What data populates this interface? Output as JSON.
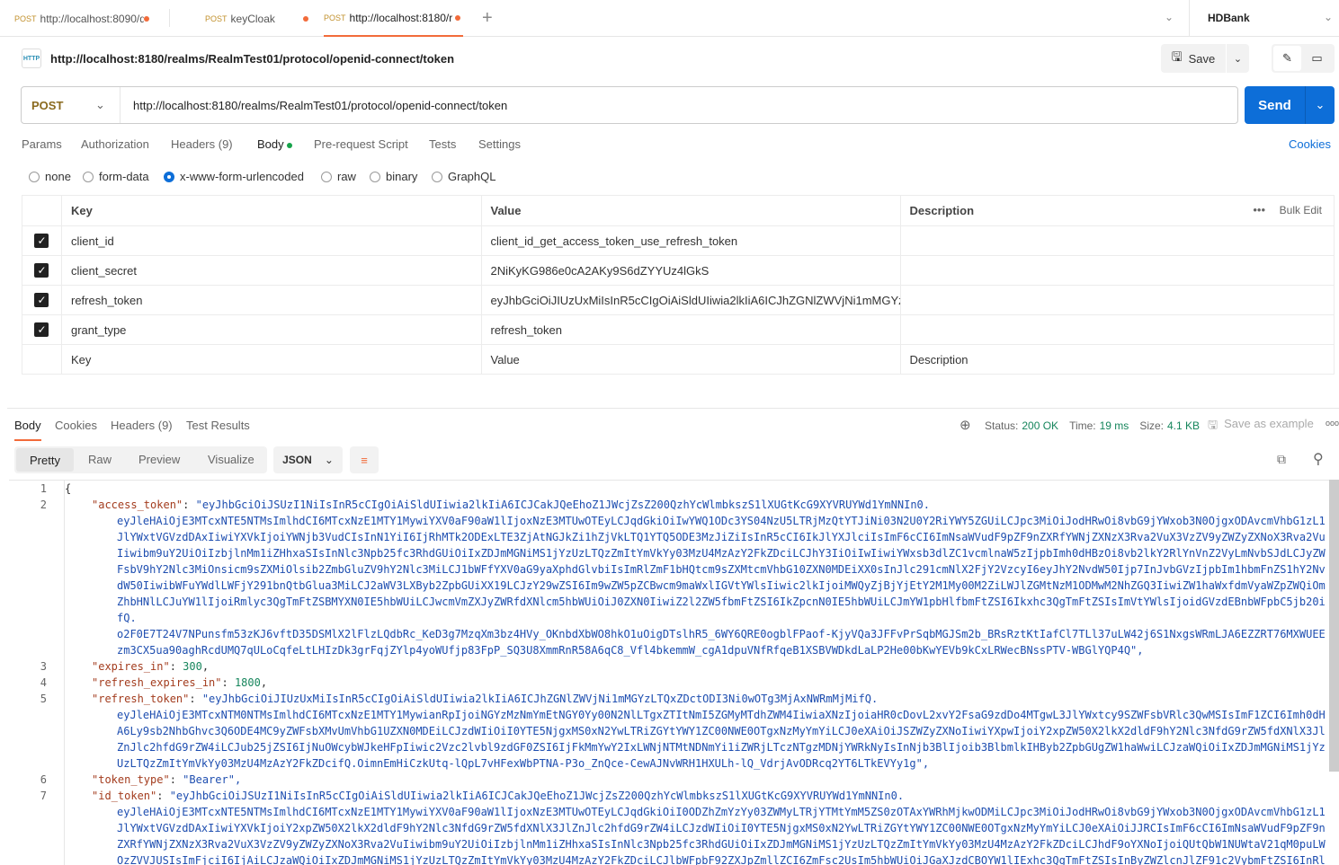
{
  "tabs": [
    {
      "method": "POST",
      "label": "http://localhost:8090/d"
    },
    {
      "method": "POST",
      "label": "keyCloak"
    },
    {
      "method": "POST",
      "label": "http://localhost:8180/r"
    }
  ],
  "workspace": "HDBank",
  "request": {
    "title": "http://localhost:8180/realms/RealmTest01/protocol/openid-connect/token",
    "method": "POST",
    "url": "http://localhost:8180/realms/RealmTest01/protocol/openid-connect/token",
    "save_label": "Save",
    "send_label": "Send"
  },
  "req_tabs": [
    "Params",
    "Authorization",
    "Headers (9)",
    "Body",
    "Pre-request Script",
    "Tests",
    "Settings"
  ],
  "cookies_label": "Cookies",
  "body_types": [
    "none",
    "form-data",
    "x-www-form-urlencoded",
    "raw",
    "binary",
    "GraphQL"
  ],
  "body_type_selected": "x-www-form-urlencoded",
  "kv_table": {
    "headers": [
      "Key",
      "Value",
      "Description"
    ],
    "bulk_edit": "Bulk Edit",
    "rows": [
      {
        "checked": true,
        "key": "client_id",
        "value": "client_id_get_access_token_use_refresh_token"
      },
      {
        "checked": true,
        "key": "client_secret",
        "value": "2NiKyKG986e0cA2AKy9S6dZYYUz4lGkS"
      },
      {
        "checked": true,
        "key": "refresh_token",
        "value": "eyJhbGciOiJIUzUxMiIsInR5cCIgOiAiSldUIiwia2lkIiA6ICJhZGNlZWVjNi1mMGYzL..."
      },
      {
        "checked": true,
        "key": "grant_type",
        "value": "refresh_token"
      }
    ],
    "placeholders": {
      "key": "Key",
      "value": "Value",
      "description": "Description"
    }
  },
  "resp_tabs": [
    "Body",
    "Cookies",
    "Headers (9)",
    "Test Results"
  ],
  "status": {
    "status_label": "Status:",
    "status": "200 OK",
    "time_label": "Time:",
    "time": "19 ms",
    "size_label": "Size:",
    "size": "4.1 KB",
    "save_example": "Save as example"
  },
  "view_modes": [
    "Pretty",
    "Raw",
    "Preview",
    "Visualize"
  ],
  "format": "JSON",
  "colors": {
    "accent": "#f26b3a",
    "send": "#0d6ed8",
    "status_ok": "#16855c"
  },
  "code_rows": [
    {
      "ln": "1",
      "type": "p",
      "text": "{"
    },
    {
      "ln": "2",
      "type": "kv",
      "key": "\"access_token\"",
      "text": "\"eyJhbGciOiJSUzI1NiIsInR5cCIgOiAiSldUIiwia2lkIiA6ICJCakJQeEhoZ1JWcjZsZ200QzhYcWlmbkszS1lXUGtKcG9XYVRUYWd1YmNNIn0."
    },
    {
      "ln": "",
      "type": "w",
      "text": "eyJleHAiOjE3MTcxNTE5NTMsImlhdCI6MTcxNzE1MTY1MywiYXV0aF90aW1lIjoxNzE3MTUwOTEyLCJqdGkiOiIwYWQ1ODc3YS04NzU5LTRjMzQtYTJiNi03N2U0Y2RiYWY5ZGUiLCJpc3MiOiJodHRwOi8vbG9jYWxob3N0OjgxODAvcmVhbG1zL1"
    },
    {
      "ln": "",
      "type": "w",
      "text": "JlYWxtVGVzdDAxIiwiYXVkIjoiYWNjb3VudCIsInN1YiI6IjRhMTk2ODExLTE3ZjAtNGJkZi1hZjVkLTQ1YTQ5ODE3MzJiZiIsInR5cCI6IkJlYXJlciIsImF6cCI6ImNsaWVudF9pZF9nZXRfYWNjZXNzX3Rva2VuX3VzZV9yZWZyZXNoX3Rva2Vu"
    },
    {
      "ln": "",
      "type": "w",
      "text": "Iiwibm9uY2UiOiIzbjlnMm1iZHhxaSIsInNlc3Npb25fc3RhdGUiOiIxZDJmMGNiMS1jYzUzLTQzZmItYmVkYy03MzU4MzAzY2FkZDciLCJhY3IiOiIwIiwiYWxsb3dlZC1vcmlnaW5zIjpbImh0dHBzOi8vb2lkY2RlYnVnZ2VyLmNvbSJdLCJyZW"
    },
    {
      "ln": "",
      "type": "w",
      "text": "FsbV9hY2Nlc3MiOnsicm9sZXMiOlsib2ZmbGluZV9hY2Nlc3MiLCJ1bWFfYXV0aG9yaXphdGlvbiIsImRlZmF1bHQtcm9sZXMtcmVhbG10ZXN0MDEiXX0sInJlc291cmNlX2FjY2VzcyI6eyJhY2NvdW50Ijp7InJvbGVzIjpbIm1hbmFnZS1hY2Nv"
    },
    {
      "ln": "",
      "type": "w",
      "text": "dW50IiwibWFuYWdlLWFjY291bnQtbGlua3MiLCJ2aWV3LXByb2ZpbGUiXX19LCJzY29wZSI6Im9wZW5pZCBwcm9maWxlIGVtYWlsIiwic2lkIjoiMWQyZjBjYjEtY2M1My00M2ZiLWJlZGMtNzM1ODMwM2NhZGQ3IiwiZW1haWxfdmVyaWZpZWQiOm"
    },
    {
      "ln": "",
      "type": "w",
      "text": "ZhbHNlLCJuYW1lIjoiRmlyc3QgTmFtZSBMYXN0IE5hbWUiLCJwcmVmZXJyZWRfdXNlcm5hbWUiOiJ0ZXN0IiwiZ2l2ZW5fbmFtZSI6IkZpcnN0IE5hbWUiLCJmYW1pbHlfbmFtZSI6Ikxhc3QgTmFtZSIsImVtYWlsIjoidGVzdEBnbWFpbC5jb20i"
    },
    {
      "ln": "",
      "type": "w",
      "text": "fQ."
    },
    {
      "ln": "",
      "type": "w",
      "text": "o2F0E7T24V7NPunsfm53zKJ6vftD35DSMlX2lFlzLQdbRc_KeD3g7MzqXm3bz4HVy_OKnbdXbWO8hkO1uOigDTslhR5_6WY6QRE0ogblFPaof-KjyVQa3JFFvPrSqbMGJSm2b_BRsRztKtIafCl7TLl37uLW42j6S1NxgsWRmLJA6EZZRT76MXWUEE"
    },
    {
      "ln": "",
      "type": "w",
      "text": "zm3CX5ua90aghRcdUMQ7qULoCqfeLtLHIzDk3grFqjZYlp4yoWUfjp83FpP_SQ3U8XmmRnR58A6qC8_Vfl4bkemmW_cgA1dpuVNfRfqeB1XSBVWDkdLaLP2He00bKwYEVb9kCxLRWecBNssPTV-WBGlYQP4Q\","
    },
    {
      "ln": "3",
      "type": "num",
      "key": "\"expires_in\"",
      "text": "300"
    },
    {
      "ln": "4",
      "type": "num",
      "key": "\"refresh_expires_in\"",
      "text": "1800"
    },
    {
      "ln": "5",
      "type": "kv",
      "key": "\"refresh_token\"",
      "text": "\"eyJhbGciOiJIUzUxMiIsInR5cCIgOiAiSldUIiwia2lkIiA6ICJhZGNlZWVjNi1mMGYzLTQxZDctODI3Ni0wOTg3MjAxNWRmMjMifQ."
    },
    {
      "ln": "",
      "type": "w",
      "text": "eyJleHAiOjE3MTcxNTM0NTMsImlhdCI6MTcxNzE1MTY1MywianRpIjoiNGYzMzNmYmEtNGY0Yy00N2NlLTgxZTItNmI5ZGMyMTdhZWM4IiwiaXNzIjoiaHR0cDovL2xvY2FsaG9zdDo4MTgwL3JlYWxtcy9SZWFsbVRlc3QwMSIsImF1ZCI6Imh0dH"
    },
    {
      "ln": "",
      "type": "w",
      "text": "A6Ly9sb2NhbGhvc3Q6ODE4MC9yZWFsbXMvUmVhbG1UZXN0MDEiLCJzdWIiOiI0YTE5NjgxMS0xN2YwLTRiZGYtYWY1ZC00NWE0OTgxNzMyYmYiLCJ0eXAiOiJSZWZyZXNoIiwiYXpwIjoiY2xpZW50X2lkX2dldF9hY2Nlc3NfdG9rZW5fdXNlX3Jl"
    },
    {
      "ln": "",
      "type": "w",
      "text": "ZnJlc2hfdG9rZW4iLCJub25jZSI6IjNuOWcybWJkeHFpIiwic2Vzc2lvbl9zdGF0ZSI6IjFkMmYwY2IxLWNjNTMtNDNmYi1iZWRjLTczNTgzMDNjYWRkNyIsInNjb3BlIjoib3BlbmlkIHByb2ZpbGUgZW1haWwiLCJzaWQiOiIxZDJmMGNiMS1jYz"
    },
    {
      "ln": "",
      "type": "w",
      "text": "UzLTQzZmItYmVkYy03MzU4MzAzY2FkZDcifQ.OimnEmHiCzkUtq-lQpL7vHFexWbPTNA-P3o_ZnQce-CewAJNvWRH1HXULh-lQ_VdrjAvODRcq2YT6LTkEVYy1g\","
    },
    {
      "ln": "6",
      "type": "kv",
      "key": "\"token_type\"",
      "text": "\"Bearer\","
    },
    {
      "ln": "7",
      "type": "kv",
      "key": "\"id_token\"",
      "text": "\"eyJhbGciOiJSUzI1NiIsInR5cCIgOiAiSldUIiwia2lkIiA6ICJCakJQeEhoZ1JWcjZsZ200QzhYcWlmbkszS1lXUGtKcG9XYVRUYWd1YmNNIn0."
    },
    {
      "ln": "",
      "type": "w",
      "text": "eyJleHAiOjE3MTcxNTE5NTMsImlhdCI6MTcxNzE1MTY1MywiYXV0aF90aW1lIjoxNzE3MTUwOTEyLCJqdGkiOiI0ODZhZmYzYy03ZWMyLTRjYTMtYmM5ZS0zOTAxYWRhMjkwODMiLCJpc3MiOiJodHRwOi8vbG9jYWxob3N0OjgxODAvcmVhbG1zL1"
    },
    {
      "ln": "",
      "type": "w",
      "text": "JlYWxtVGVzdDAxIiwiYXVkIjoiY2xpZW50X2lkX2dldF9hY2Nlc3NfdG9rZW5fdXNlX3JlZnJlc2hfdG9rZW4iLCJzdWIiOiI0YTE5NjgxMS0xN2YwLTRiZGYtYWY1ZC00NWE0OTgxNzMyYmYiLCJ0eXAiOiJJRCIsImF6cCI6ImNsaWVudF9pZF9n"
    },
    {
      "ln": "",
      "type": "w",
      "text": "ZXRfYWNjZXNzX3Rva2VuX3VzZV9yZWZyZXNoX3Rva2VuIiwibm9uY2UiOiIzbjlnMm1iZHhxaSIsInNlc3Npb25fc3RhdGUiOiIxZDJmMGNiMS1jYzUzLTQzZmItYmVkYy03MzU4MzAzY2FkZDciLCJhdF9oYXNoIjoiQUtQbW1NUWtaV21qM0puLW"
    },
    {
      "ln": "",
      "type": "w",
      "text": "OzZVVJUSIsImFjciI6IjAiLCJzaWQiOiIxZDJmMGNiMS1jYzUzLTQzZmItYmVkYy03MzU4MzAzY2FkZDciLCJlbWFpbF92ZXJpZmllZCI6ZmFsc2UsIm5hbWUiOiJGaXJzdCBOYW1lIExhc3QgTmFtZSIsInByZWZlcnJlZF91c2VybmFtZSI6InRl"
    }
  ]
}
